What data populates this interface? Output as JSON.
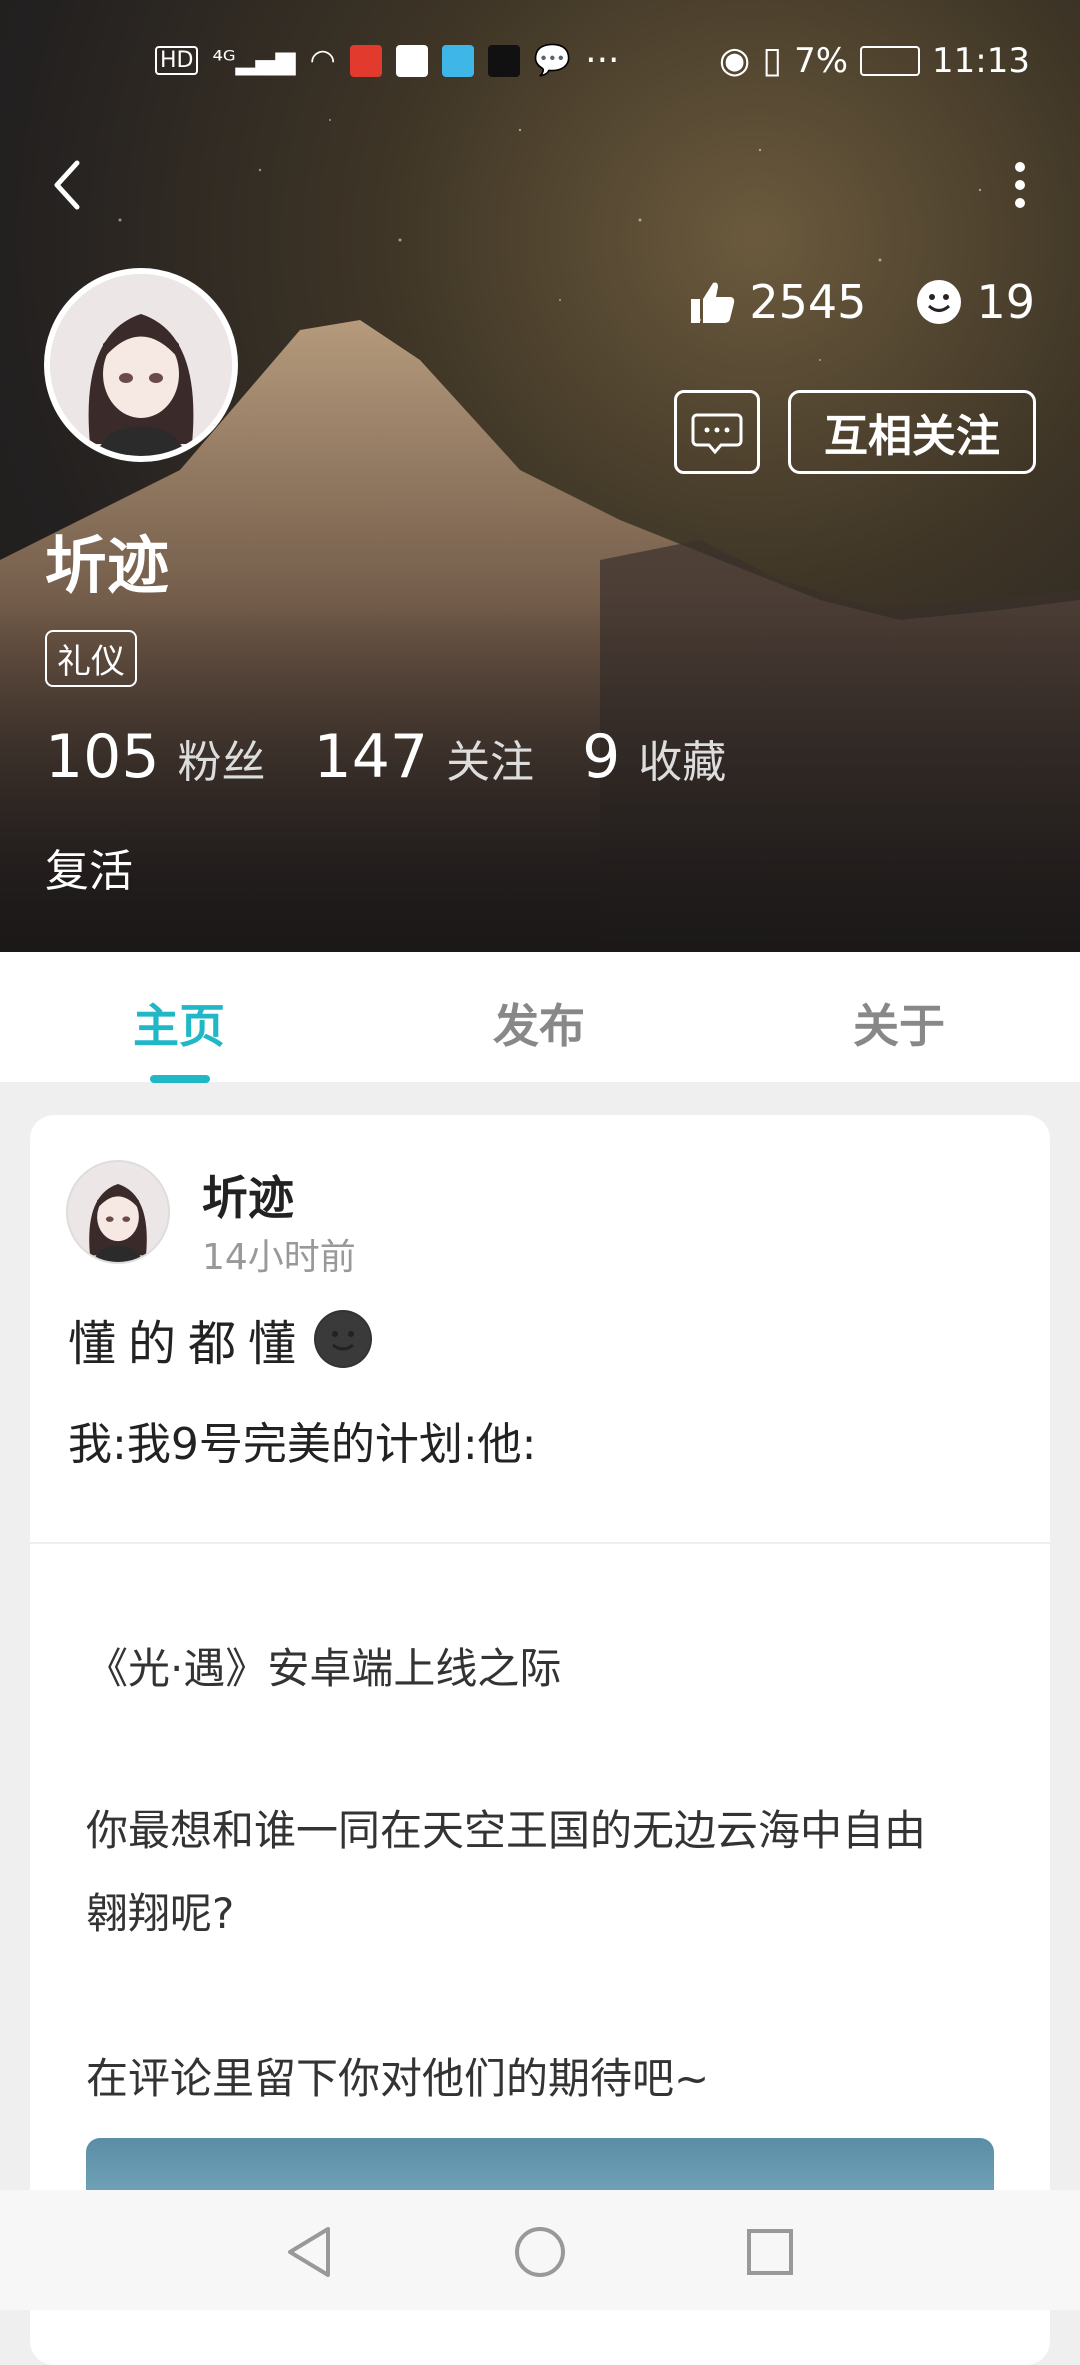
{
  "status_bar": {
    "left_icons": [
      "hd-icon",
      "4g-signal-icon",
      "wifi-icon",
      "ting-app-icon",
      "app-icon",
      "video-app-icon",
      "tiktok-icon",
      "chat-bubble-icon"
    ],
    "more": "···",
    "battery": "7%",
    "time": "11:13"
  },
  "profile": {
    "likes": "2545",
    "emoji_count": "19",
    "follow_label": "互相关注",
    "username": "圻迹",
    "tag": "礼仪",
    "fans_num": "105",
    "fans_label": "粉丝",
    "following_num": "147",
    "following_label": "关注",
    "favorites_num": "9",
    "favorites_label": "收藏",
    "bio": "复活"
  },
  "tabs": [
    "主页",
    "发布",
    "关于"
  ],
  "post": {
    "author": "圻迹",
    "time": "14小时前",
    "line1": "懂的都懂",
    "line2": "我:我9号完美的计划:他:",
    "shared_text_1": "《光·遇》安卓端上线之际",
    "shared_text_2a": "你最想和谁一同在天空王国的无边云海中自由",
    "shared_text_2b": "翱翔呢?",
    "shared_text_3": "在评论里留下你对他们的期待吧~"
  },
  "colors": {
    "accent": "#20b7c6"
  }
}
